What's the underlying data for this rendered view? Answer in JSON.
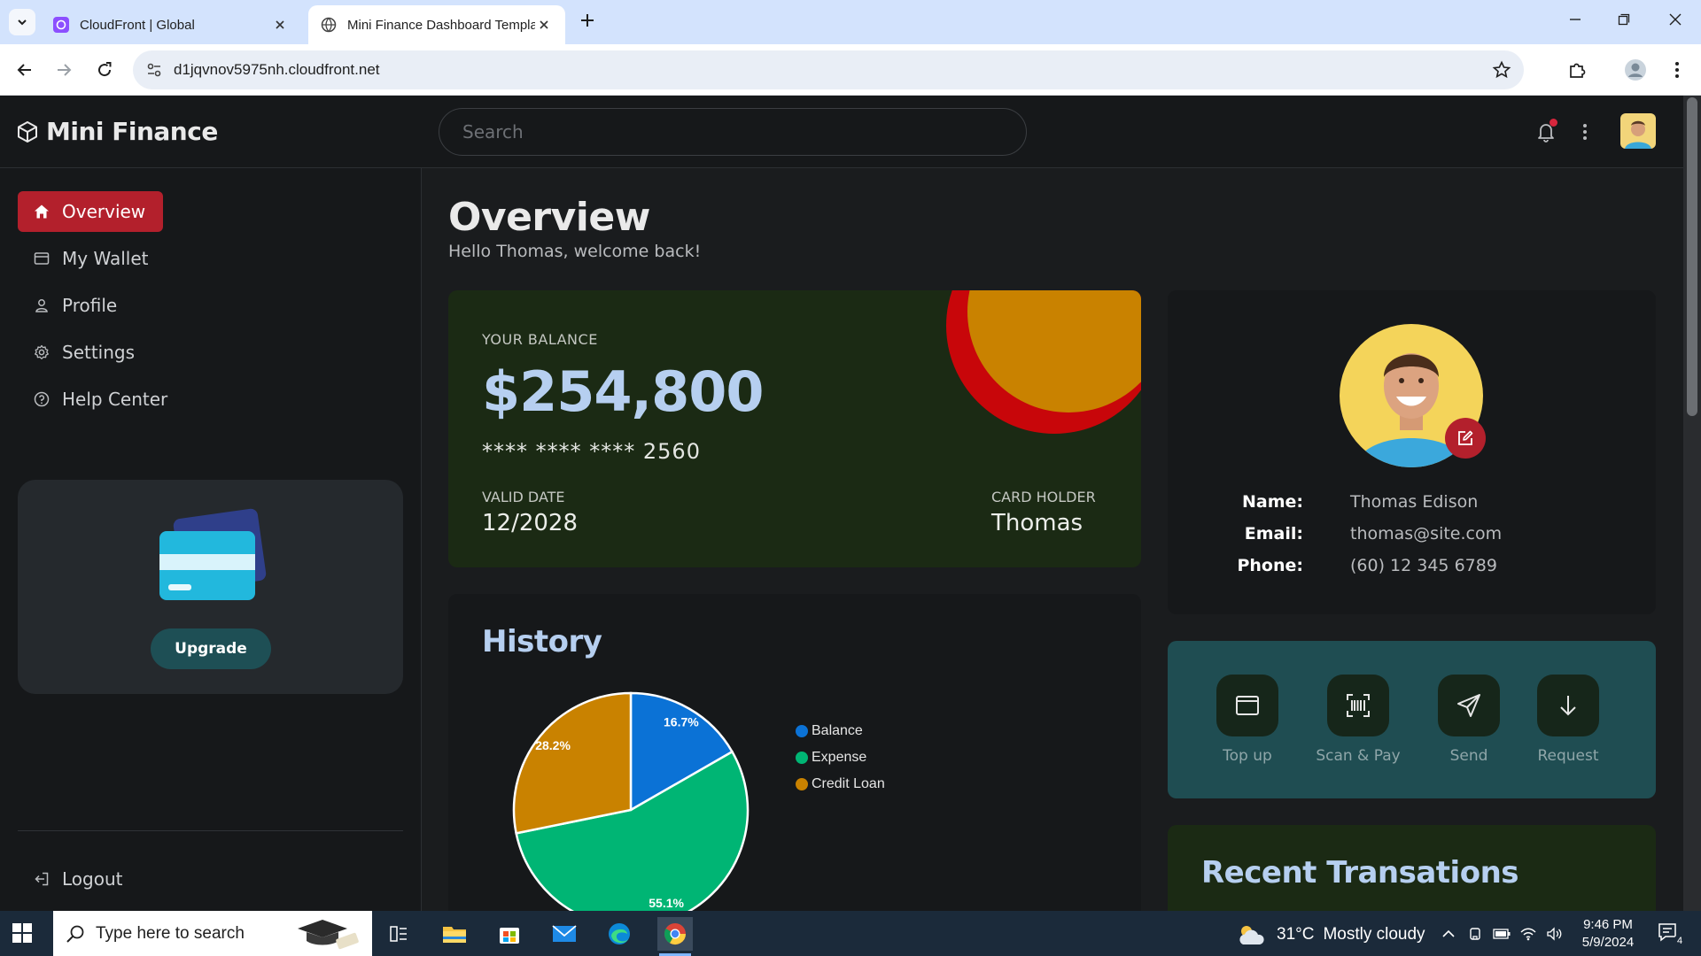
{
  "browser": {
    "tabs": [
      {
        "title": "CloudFront | Global"
      },
      {
        "title": "Mini Finance Dashboard Templa"
      }
    ],
    "url": "d1jqvnov5975nh.cloudfront.net"
  },
  "app": {
    "brand": "Mini Finance",
    "search_placeholder": "Search"
  },
  "sidebar": {
    "items": [
      {
        "label": "Overview",
        "icon": "home-icon",
        "active": true
      },
      {
        "label": "My Wallet",
        "icon": "wallet-icon"
      },
      {
        "label": "Profile",
        "icon": "user-icon"
      },
      {
        "label": "Settings",
        "icon": "gear-icon"
      },
      {
        "label": "Help Center",
        "icon": "help-icon"
      }
    ],
    "upgrade_label": "Upgrade",
    "logout_label": "Logout"
  },
  "overview": {
    "title": "Overview",
    "subtitle": "Hello Thomas, welcome back!"
  },
  "balance": {
    "label": "YOUR BALANCE",
    "amount": "$254,800",
    "card_masked": "****  ****  ****  2560",
    "valid_label": "VALID DATE",
    "valid_value": "12/2028",
    "holder_label": "CARD HOLDER",
    "holder_value": "Thomas"
  },
  "profile": {
    "name_label": "Name:",
    "name": "Thomas Edison",
    "email_label": "Email:",
    "email": "thomas@site.com",
    "phone_label": "Phone:",
    "phone": "(60) 12 345 6789"
  },
  "actions": [
    {
      "label": "Top up",
      "icon": "topup-icon"
    },
    {
      "label": "Scan & Pay",
      "icon": "barcode-icon"
    },
    {
      "label": "Send",
      "icon": "send-icon"
    },
    {
      "label": "Request",
      "icon": "arrow-down-icon"
    }
  ],
  "recent": {
    "title": "Recent Transations"
  },
  "history": {
    "title": "History"
  },
  "chart_data": {
    "type": "pie",
    "title": "History",
    "labels": [
      "Balance",
      "Expense",
      "Credit Loan"
    ],
    "values": [
      16.7,
      55.1,
      28.2
    ],
    "value_labels": [
      "16.7%",
      "55.1%",
      "28.2%"
    ],
    "colors": [
      "#0b72d6",
      "#00b574",
      "#c98200"
    ],
    "legend_position": "right"
  },
  "taskbar": {
    "search_placeholder": "Type here to search",
    "weather_temp": "31°C",
    "weather_desc": "Mostly cloudy",
    "time": "9:46 PM",
    "date": "5/9/2024",
    "notification_count": "4"
  }
}
